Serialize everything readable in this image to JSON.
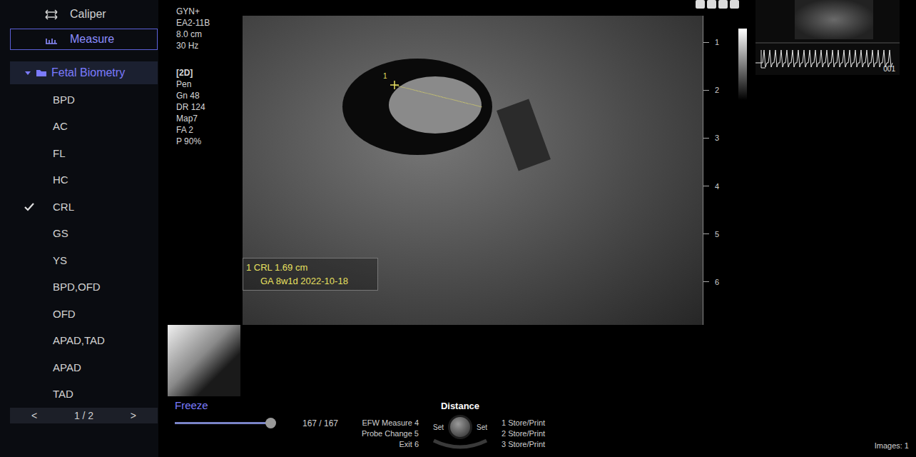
{
  "sidebar": {
    "tools": [
      {
        "label": "Caliper",
        "selected": false
      },
      {
        "label": "Measure",
        "selected": true
      }
    ],
    "folder": {
      "label": "Fetal Biometry",
      "expanded": true,
      "selected": true
    },
    "items": [
      {
        "label": "BPD",
        "checked": false
      },
      {
        "label": "AC",
        "checked": false
      },
      {
        "label": "FL",
        "checked": false
      },
      {
        "label": "HC",
        "checked": false
      },
      {
        "label": "CRL",
        "checked": true
      },
      {
        "label": "GS",
        "checked": false
      },
      {
        "label": "YS",
        "checked": false
      },
      {
        "label": "BPD,OFD",
        "checked": false
      },
      {
        "label": "OFD",
        "checked": false
      },
      {
        "label": "APAD,TAD",
        "checked": false
      },
      {
        "label": "APAD",
        "checked": false
      },
      {
        "label": "TAD",
        "checked": false
      }
    ],
    "pager": {
      "prev": "<",
      "page": "1 / 2",
      "next": ">"
    }
  },
  "params": {
    "probe": [
      "GYN+",
      "EA2-11B",
      "8.0 cm",
      "30 Hz"
    ],
    "mode": "[2D]",
    "settings": [
      "Pen",
      "Gn 48",
      "DR 124",
      "Map7",
      "FA 2",
      "P 90%"
    ]
  },
  "image": {
    "caliper": "1",
    "measurement": [
      "1 CRL 1.69 cm",
      "GA 8w1d 2022-10-18"
    ],
    "depth_scale": [
      "1",
      "2",
      "3",
      "4",
      "5",
      "6"
    ]
  },
  "thumbnail": {
    "label": "001"
  },
  "cine": {
    "button": "Freeze",
    "level": 1,
    "frames": "167 / 167"
  },
  "softkeys": [
    "EFW Measure 4",
    "Probe Change 5",
    "Exit 6"
  ],
  "knob": {
    "title": "Distance",
    "left": "Set",
    "right": "Set"
  },
  "store": [
    "1 Store/Print",
    "2 Store/Print",
    "3 Store/Print"
  ],
  "status": "Images: 1"
}
